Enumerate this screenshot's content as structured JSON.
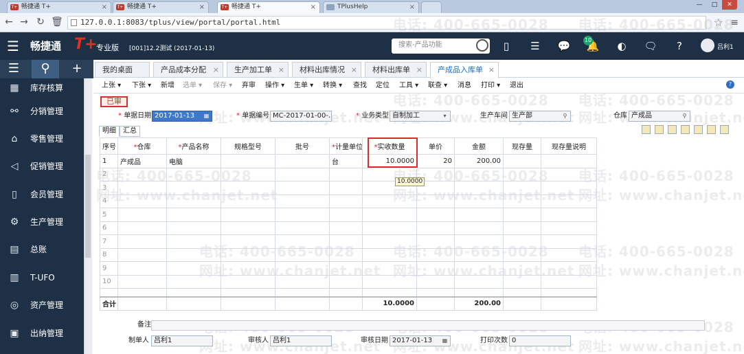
{
  "browser": {
    "tabs": [
      {
        "title": "畅捷通 T+",
        "icon": "tplus-favicon"
      },
      {
        "title": "畅捷通 T+",
        "icon": "tplus-favicon"
      },
      {
        "title": "畅捷通 T+",
        "icon": "tplus-favicon"
      },
      {
        "title": "TPlusHelp",
        "icon": "page-icon"
      }
    ],
    "url": "127.0.0.1:8083/tplus/view/portal/portal.html"
  },
  "header": {
    "brand": "畅捷通",
    "brand_mark": "T+",
    "edition": "专业版",
    "account_info": "[001]12.2测试  (2017-01-13)",
    "search_placeholder": "搜索-产品功能",
    "notification_count": "10",
    "user_name": "吕利1"
  },
  "sidebar": {
    "items": [
      {
        "label": "库存核算",
        "icon": "inventory-icon"
      },
      {
        "label": "分销管理",
        "icon": "distribution-icon"
      },
      {
        "label": "零售管理",
        "icon": "retail-icon"
      },
      {
        "label": "促销管理",
        "icon": "megaphone-icon"
      },
      {
        "label": "会员管理",
        "icon": "member-icon"
      },
      {
        "label": "生产管理",
        "icon": "gears-icon"
      },
      {
        "label": "总账",
        "icon": "ledger-icon"
      },
      {
        "label": "T-UFO",
        "icon": "report-icon"
      },
      {
        "label": "资产管理",
        "icon": "asset-icon"
      },
      {
        "label": "出纳管理",
        "icon": "cashier-icon"
      }
    ]
  },
  "page_tabs": [
    "我的桌面",
    "产品成本分配",
    "生产加工单",
    "材料出库情况",
    "材料出库单",
    "产成品入库单"
  ],
  "toolbar": [
    "上张",
    "下张",
    "新增",
    "选单",
    "保存",
    "弃审",
    "操作",
    "生单",
    "转换",
    "查找",
    "定位",
    "工具",
    "联查",
    "消息",
    "打印",
    "退出"
  ],
  "form": {
    "status": "已审",
    "date_label": "单据日期",
    "date_value": "2017-01-13",
    "code_label": "单据编号",
    "code_value": "MC-2017-01-00-...",
    "biz_label": "业务类型",
    "biz_value": "自制加工",
    "workshop_label": "生产车间",
    "workshop_value": "生产部",
    "warehouse_label": "仓库",
    "warehouse_value": "产成品"
  },
  "subtabs": [
    "明细",
    "汇总"
  ],
  "grid": {
    "headers": [
      "序号",
      "仓库",
      "产品名称",
      "规格型号",
      "批号",
      "计量单位",
      "实收数量",
      "单价",
      "金额",
      "现存量",
      "现存量说明"
    ],
    "rows": [
      [
        "1",
        "产成品",
        "电脑",
        "",
        "",
        "台",
        "10.0000",
        "20",
        "200.00",
        "",
        ""
      ],
      [
        "2",
        "",
        "",
        "",
        "",
        "",
        "",
        "",
        "",
        "",
        ""
      ],
      [
        "3",
        "",
        "",
        "",
        "",
        "",
        "",
        "",
        "",
        "",
        ""
      ],
      [
        "4",
        "",
        "",
        "",
        "",
        "",
        "",
        "",
        "",
        "",
        ""
      ],
      [
        "5",
        "",
        "",
        "",
        "",
        "",
        "",
        "",
        "",
        "",
        ""
      ],
      [
        "6",
        "",
        "",
        "",
        "",
        "",
        "",
        "",
        "",
        "",
        ""
      ],
      [
        "7",
        "",
        "",
        "",
        "",
        "",
        "",
        "",
        "",
        "",
        ""
      ],
      [
        "8",
        "",
        "",
        "",
        "",
        "",
        "",
        "",
        "",
        "",
        ""
      ],
      [
        "9",
        "",
        "",
        "",
        "",
        "",
        "",
        "",
        "",
        "",
        ""
      ],
      [
        "10",
        "",
        "",
        "",
        "",
        "",
        "",
        "",
        "",
        "",
        ""
      ]
    ],
    "total_label": "合计",
    "total_qty": "10.0000",
    "total_amount": "200.00",
    "tooltip": "10.0000"
  },
  "footer": {
    "remark_label": "备注",
    "maker_label": "制单人",
    "maker_value": "吕利1",
    "auditor_label": "审核人",
    "auditor_value": "吕利1",
    "audit_date_label": "审核日期",
    "audit_date_value": "2017-01-13",
    "print_count_label": "打印次数",
    "print_count_value": "0"
  },
  "watermark": {
    "phone": "电话: 400-665-0028",
    "site": "网址: www.chanjet.net"
  },
  "colors": {
    "sidebar_bg": "#1d3046",
    "accent_red": "#d82b2b",
    "active_tab": "#1b6ec2"
  }
}
